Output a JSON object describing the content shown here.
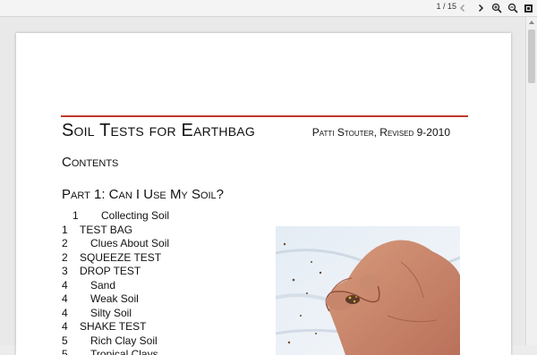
{
  "viewer": {
    "page_counter": "1 / 15",
    "icons": [
      "chevron-left-icon",
      "chevron-right-icon",
      "zoom-in-icon",
      "zoom-out-icon",
      "fullscreen-icon"
    ]
  },
  "document": {
    "title": "Soil Tests for Earthbag",
    "author": "Patti Stouter, Revised 9-2010",
    "contents_heading": "Contents",
    "part_heading": "Part 1: Can I Use My Soil?",
    "toc": [
      {
        "num": "1",
        "text": "Collecting Soil",
        "level": 2
      },
      {
        "num": "1",
        "text": "TEST BAG",
        "level": 1
      },
      {
        "num": "2",
        "text": "Clues About Soil",
        "level": 2
      },
      {
        "num": "2",
        "text": "SQUEEZE TEST",
        "level": 1
      },
      {
        "num": "3",
        "text": "DROP TEST",
        "level": 1
      },
      {
        "num": "4",
        "text": "Sand",
        "level": 2
      },
      {
        "num": "4",
        "text": "Weak Soil",
        "level": 2
      },
      {
        "num": "4",
        "text": "Silty Soil",
        "level": 2
      },
      {
        "num": "4",
        "text": "SHAKE TEST",
        "level": 1
      },
      {
        "num": "5",
        "text": "Rich Clay Soil",
        "level": 2
      },
      {
        "num": "5",
        "text": "Tropical Clays",
        "level": 2
      }
    ],
    "accent_color": "#c0392b"
  }
}
